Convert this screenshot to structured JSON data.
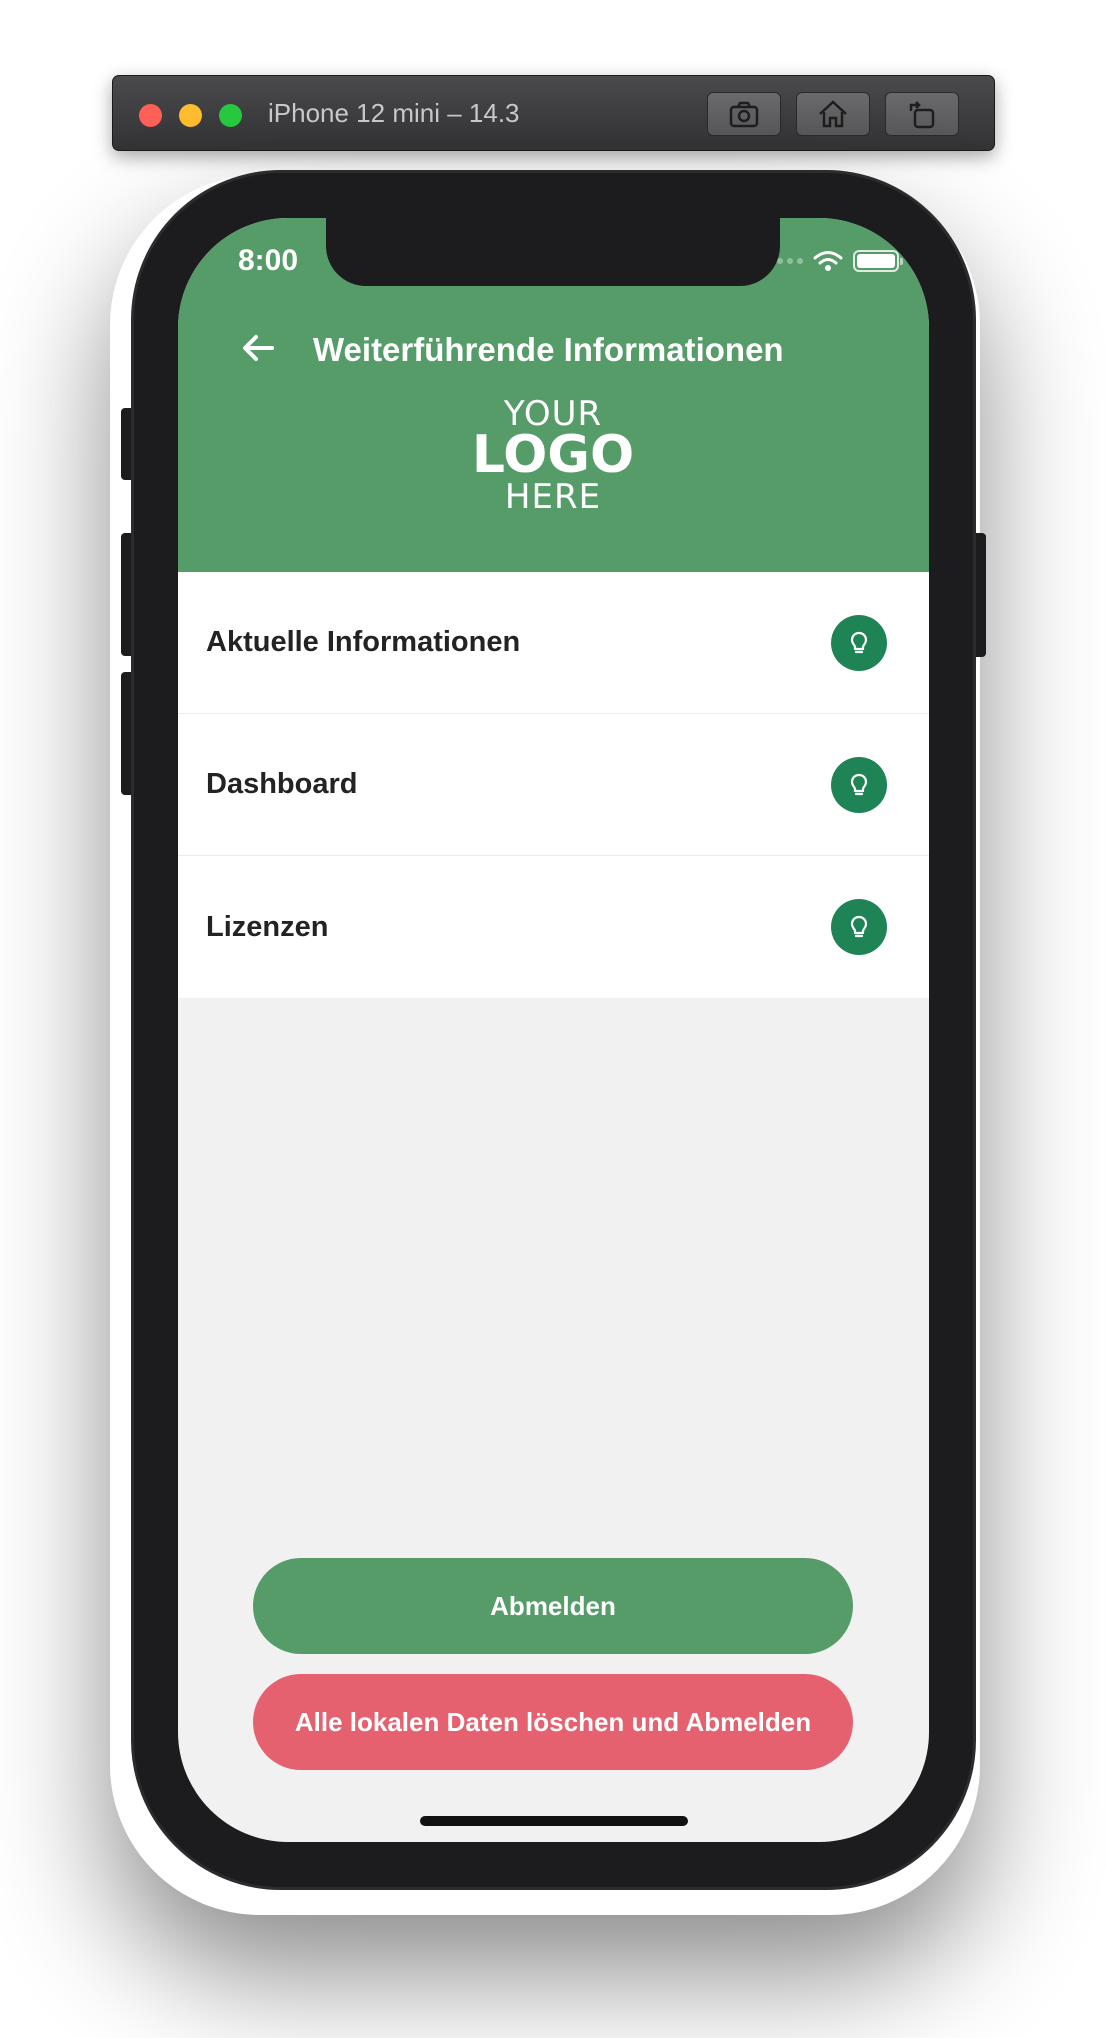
{
  "simulator": {
    "title": "iPhone 12 mini – 14.3",
    "buttons": [
      "screenshot-icon",
      "home-icon",
      "rotate-icon"
    ]
  },
  "status_bar": {
    "time": "8:00"
  },
  "header": {
    "title": "Weiterführende Informationen",
    "logo": {
      "line1": "YOUR",
      "line2": "LOGO",
      "line3": "HERE"
    },
    "color": "#569c69"
  },
  "list": {
    "items": [
      {
        "label": "Aktuelle Informationen",
        "icon": "lightbulb-icon"
      },
      {
        "label": "Dashboard",
        "icon": "lightbulb-icon"
      },
      {
        "label": "Lizenzen",
        "icon": "lightbulb-icon"
      }
    ],
    "icon_color": "#1e8456"
  },
  "actions": {
    "logout_label": "Abmelden",
    "delete_label": "Alle lokalen Daten löschen und Abmelden",
    "logout_color": "#569c69",
    "delete_color": "#e5616f"
  }
}
